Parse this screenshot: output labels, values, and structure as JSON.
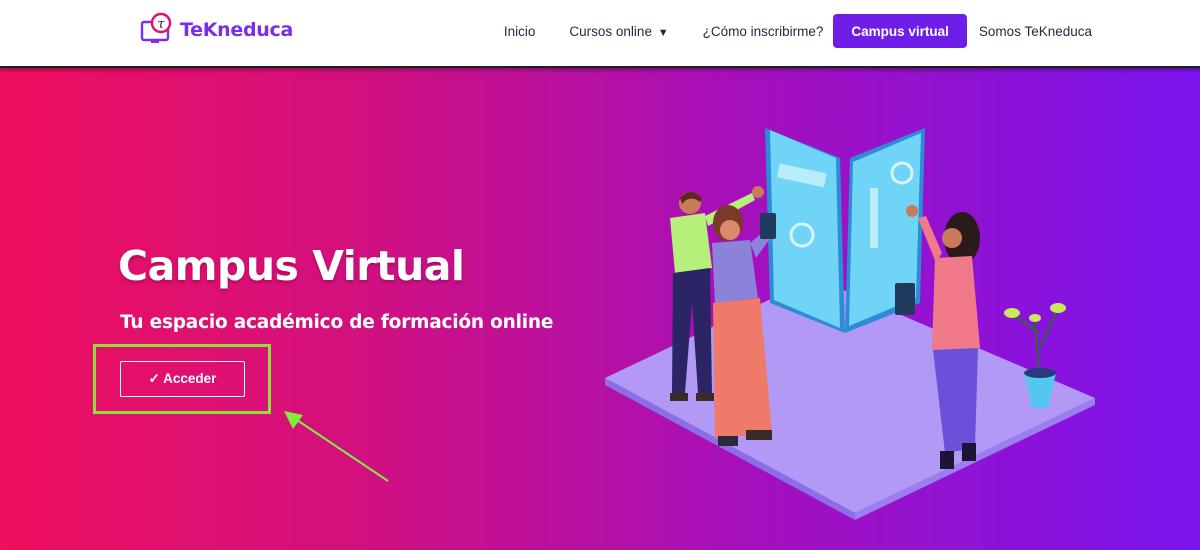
{
  "brand": {
    "name": "TeKneduca",
    "icon": "tekneduca-logo-icon",
    "color": "#7a2ee8"
  },
  "nav": {
    "items": [
      {
        "label": "Inicio"
      },
      {
        "label": "Cursos online",
        "caret": "▼"
      },
      {
        "label": "¿Cómo inscribirme?"
      }
    ],
    "cta": {
      "label": "Campus virtual",
      "color": "#6f1ee8"
    },
    "last": {
      "label": "Somos TeKneduca"
    }
  },
  "hero": {
    "title": "Campus Virtual",
    "subtitle": "Tu espacio académico de formación online",
    "button": {
      "label": "✓ Acceder"
    },
    "gradient": [
      "#ee0f5e",
      "#d2107f",
      "#a510bb",
      "#7a14ee"
    ],
    "highlight_color": "#8fe13a",
    "illustration": "people-with-tablets-illustration"
  }
}
